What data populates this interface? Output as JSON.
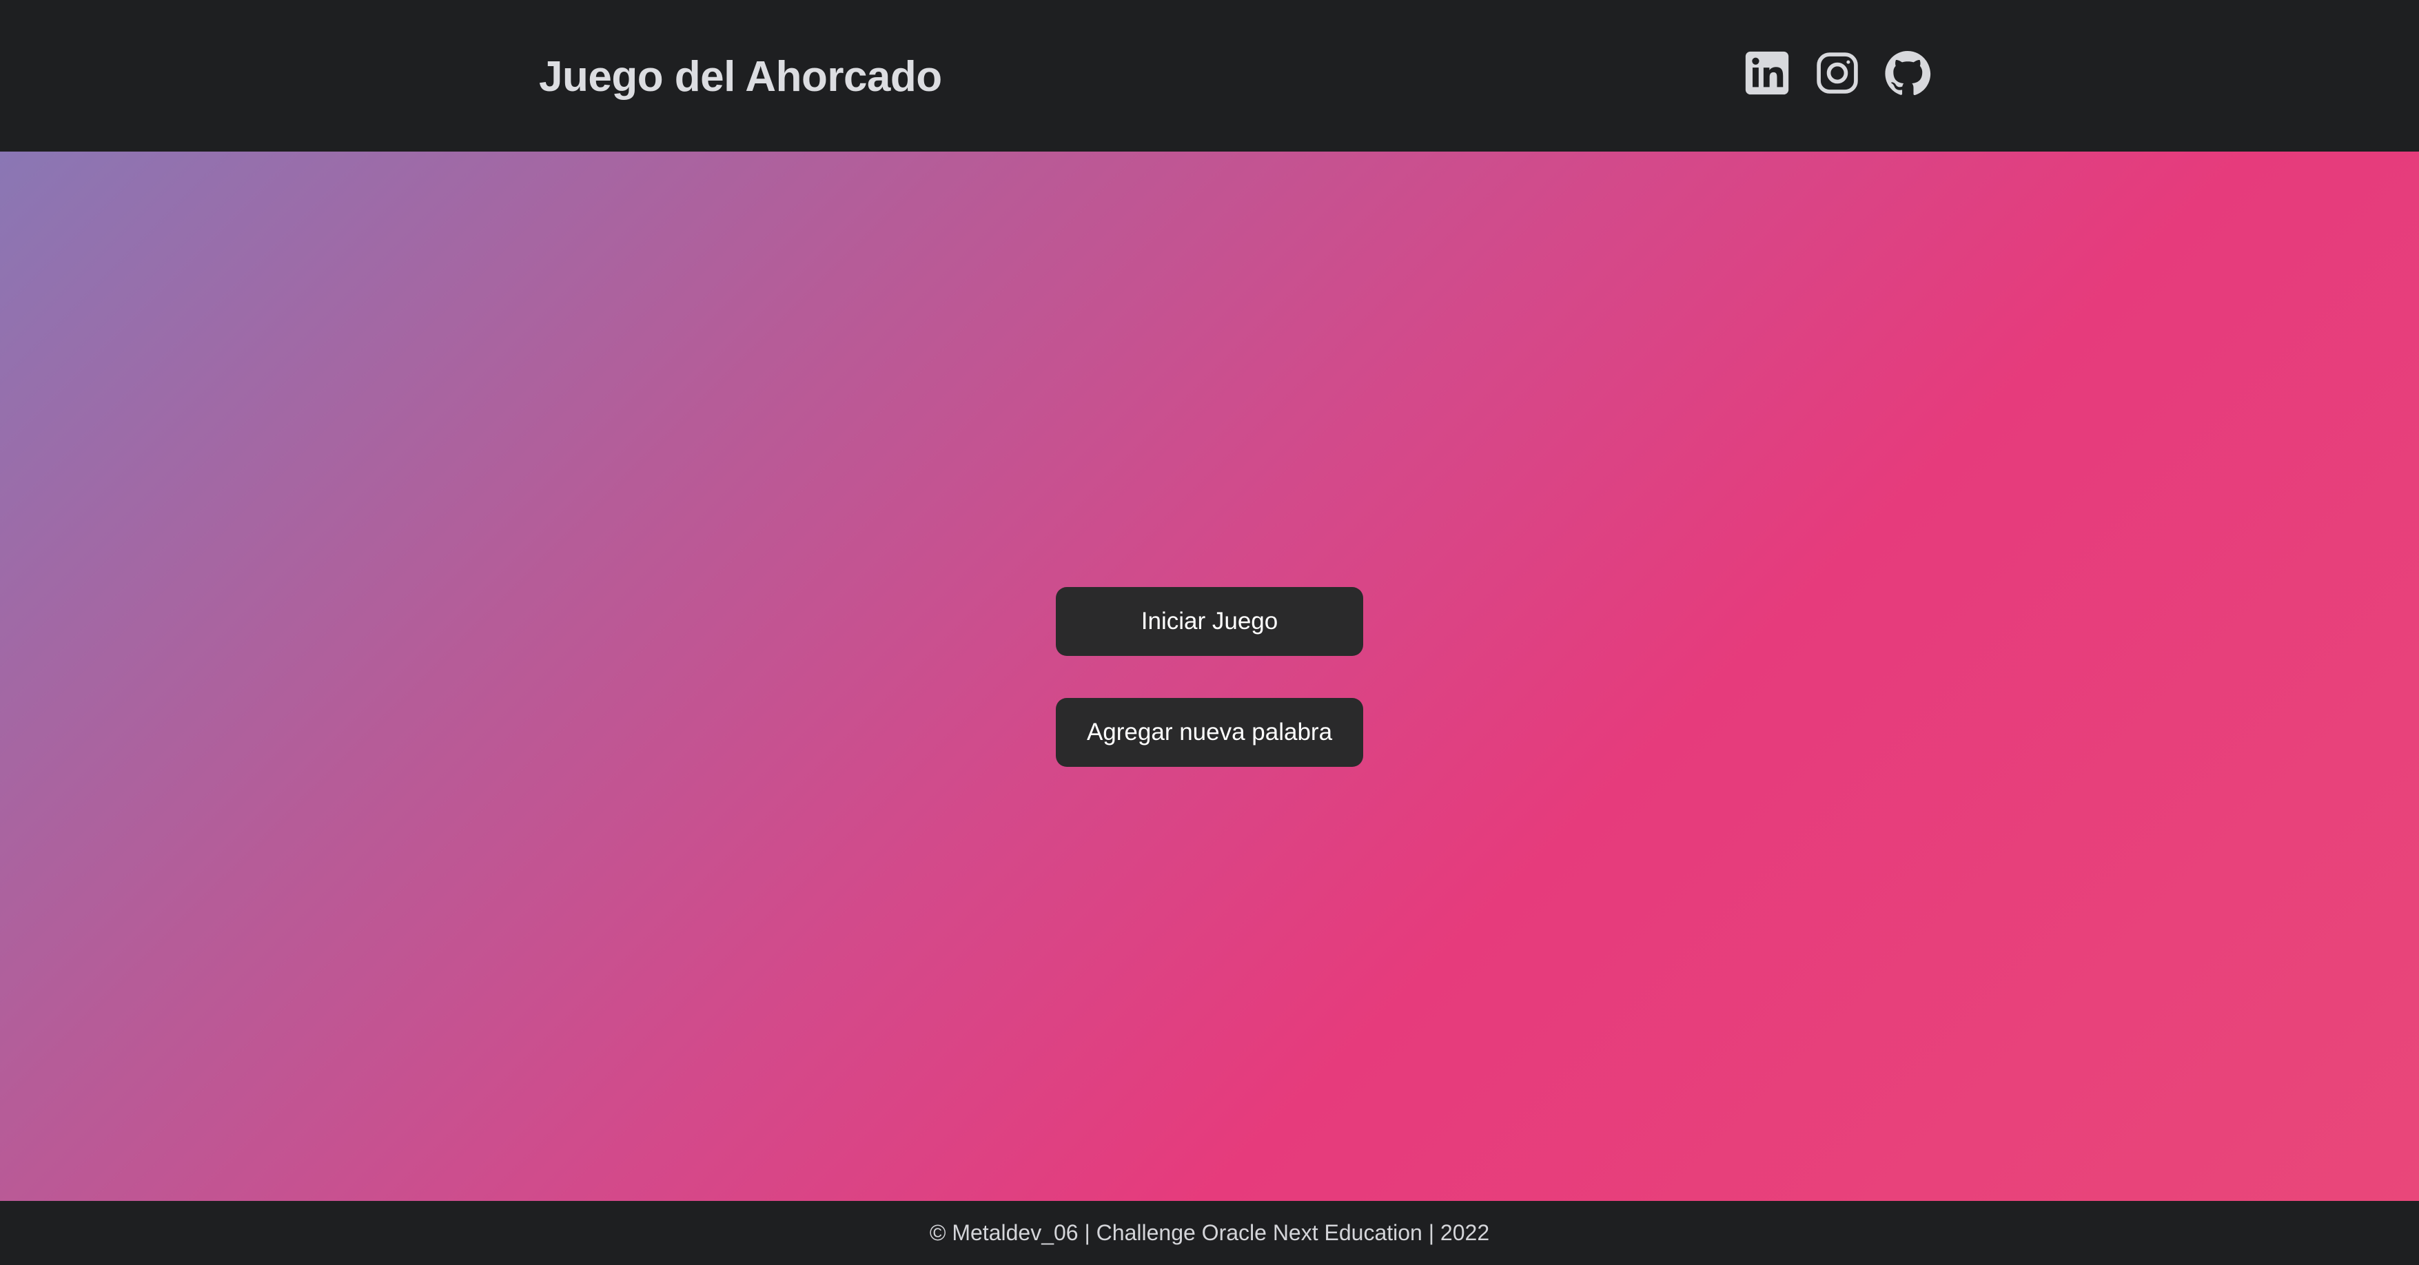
{
  "header": {
    "title": "Juego del Ahorcado",
    "social": [
      {
        "name": "linkedin-icon"
      },
      {
        "name": "instagram-icon"
      },
      {
        "name": "github-icon"
      }
    ]
  },
  "main": {
    "start_button": "Iniciar Juego",
    "add_word_button": "Agregar nueva palabra"
  },
  "footer": {
    "text": "© Metaldev_06 | Challenge Oracle Next Education | 2022"
  },
  "colors": {
    "bar_background": "#1e1f21",
    "button_background": "#2a2a2b",
    "gradient_start": "#8a77b4",
    "gradient_mid": "#d4498a",
    "gradient_end": "#e63b7c"
  }
}
